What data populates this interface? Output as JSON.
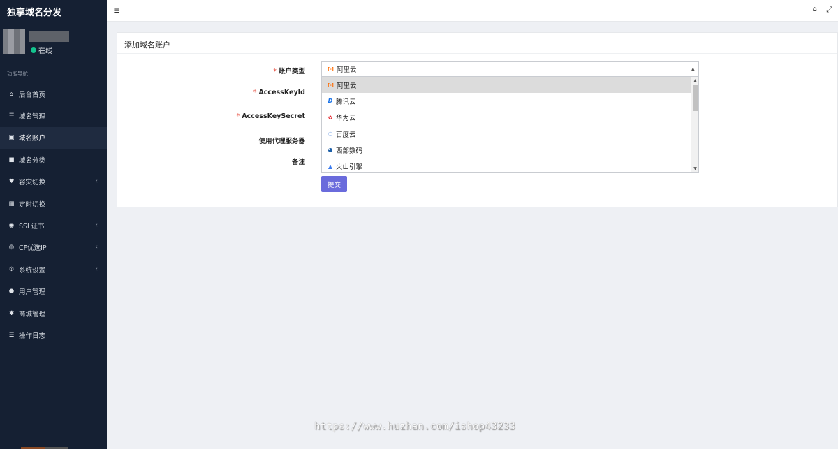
{
  "brand": {
    "title": "独享域名分发"
  },
  "user": {
    "status": "在线"
  },
  "sidebar": {
    "header": "功能导航",
    "items": [
      {
        "label": "后台首页",
        "icon": "home-icon",
        "glyph": "⌂"
      },
      {
        "label": "域名管理",
        "icon": "list-icon",
        "glyph": "☰"
      },
      {
        "label": "域名账户",
        "icon": "lock-icon",
        "glyph": "🔒",
        "active": true
      },
      {
        "label": "域名分类",
        "icon": "folder-icon",
        "glyph": "■"
      },
      {
        "label": "容灾切换",
        "icon": "heartbeat-icon",
        "glyph": "♥",
        "caret": "‹"
      },
      {
        "label": "定时切换",
        "icon": "calendar-icon",
        "glyph": "▦"
      },
      {
        "label": "SSL证书",
        "icon": "certificate-icon",
        "glyph": "◉",
        "caret": "‹"
      },
      {
        "label": "CF优选IP",
        "icon": "globe-icon",
        "glyph": "◍",
        "caret": "‹"
      },
      {
        "label": "系统设置",
        "icon": "gears-icon",
        "glyph": "⚙",
        "caret": "‹"
      },
      {
        "label": "用户管理",
        "icon": "user-icon",
        "glyph": "●"
      },
      {
        "label": "商城管理",
        "icon": "cog-icon",
        "glyph": "✱"
      },
      {
        "label": "操作日志",
        "icon": "list-icon",
        "glyph": "☰"
      }
    ]
  },
  "topbar": {
    "menu_glyph": "≡",
    "home_glyph": "⌂",
    "fullscreen_glyph": "⤢"
  },
  "form": {
    "title": "添加域名账户",
    "labels": {
      "account_type": "账户类型",
      "access_key_id": "AccessKeyId",
      "access_key_secret": "AccessKeySecret",
      "proxy": "使用代理服务器",
      "remark": "备注"
    },
    "required_mark": "*",
    "account_type_selected": "阿里云",
    "options": [
      {
        "label": "阿里云",
        "icon": "aliyun-icon",
        "glyph": "[-]",
        "color": "#ff6a00"
      },
      {
        "label": "腾讯云",
        "icon": "dnspod-icon",
        "glyph": "D",
        "color": "#1a73e8"
      },
      {
        "label": "华为云",
        "icon": "huawei-icon",
        "glyph": "✿",
        "color": "#e3262e"
      },
      {
        "label": "百度云",
        "icon": "baidu-icon",
        "glyph": "◌",
        "color": "#2b6fd6"
      },
      {
        "label": "西部数码",
        "icon": "west-icon",
        "glyph": "◕",
        "color": "#1d5fa8"
      },
      {
        "label": "火山引擎",
        "icon": "volcengine-icon",
        "glyph": "▲",
        "color": "#3a7bf0"
      }
    ],
    "submit": "提交"
  },
  "watermark": "https://www.huzhan.com/ishop43233"
}
